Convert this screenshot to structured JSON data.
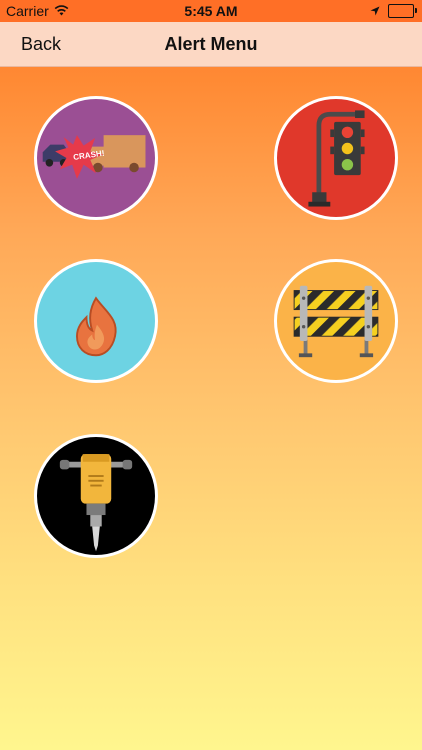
{
  "status_bar": {
    "carrier": "Carrier",
    "time": "5:45 AM",
    "icons": [
      "wifi-icon",
      "location-arrow-icon",
      "battery-icon"
    ]
  },
  "nav": {
    "back_label": "Back",
    "title": "Alert Menu"
  },
  "alerts": [
    {
      "id": "crash",
      "icon": "car-crash-icon",
      "badge_text": "CRASH!",
      "bg_color": "#9b4f94"
    },
    {
      "id": "traffic-light",
      "icon": "traffic-light-icon",
      "bg_color": "#e0382b"
    },
    {
      "id": "fire",
      "icon": "fire-icon",
      "bg_color": "#6dd3e3"
    },
    {
      "id": "road-barrier",
      "icon": "road-barrier-icon",
      "bg_color": "#fbb348"
    },
    {
      "id": "construction",
      "icon": "jackhammer-icon",
      "bg_color": "#000000"
    }
  ]
}
